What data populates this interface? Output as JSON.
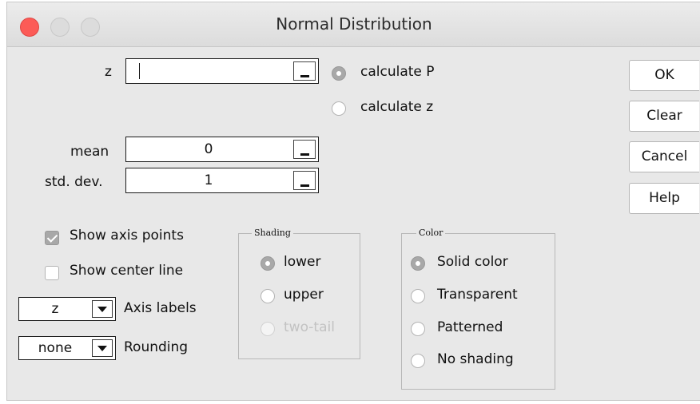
{
  "window": {
    "title": "Normal Distribution"
  },
  "fields": {
    "z": {
      "label": "z",
      "value": ""
    },
    "mean": {
      "label": "mean",
      "value": "0"
    },
    "std": {
      "label": "std. dev.",
      "value": "1"
    }
  },
  "calc": {
    "options": [
      "calculate P",
      "calculate z"
    ],
    "selected": "calculate P"
  },
  "buttons": {
    "ok": "OK",
    "clear": "Clear",
    "cancel": "Cancel",
    "help": "Help"
  },
  "checks": {
    "show_axis_points": {
      "label": "Show axis points",
      "checked": true
    },
    "show_center_line": {
      "label": "Show center line",
      "checked": false
    }
  },
  "axis_labels": {
    "value": "z",
    "label": "Axis labels"
  },
  "rounding": {
    "value": "none",
    "label": "Rounding"
  },
  "shading": {
    "title": "Shading",
    "options": [
      "lower",
      "upper",
      "two-tail"
    ],
    "selected": "lower",
    "disabled": [
      "two-tail"
    ]
  },
  "color": {
    "title": "Color",
    "options": [
      "Solid color",
      "Transparent",
      "Patterned",
      "No shading"
    ],
    "selected": "Solid color"
  }
}
